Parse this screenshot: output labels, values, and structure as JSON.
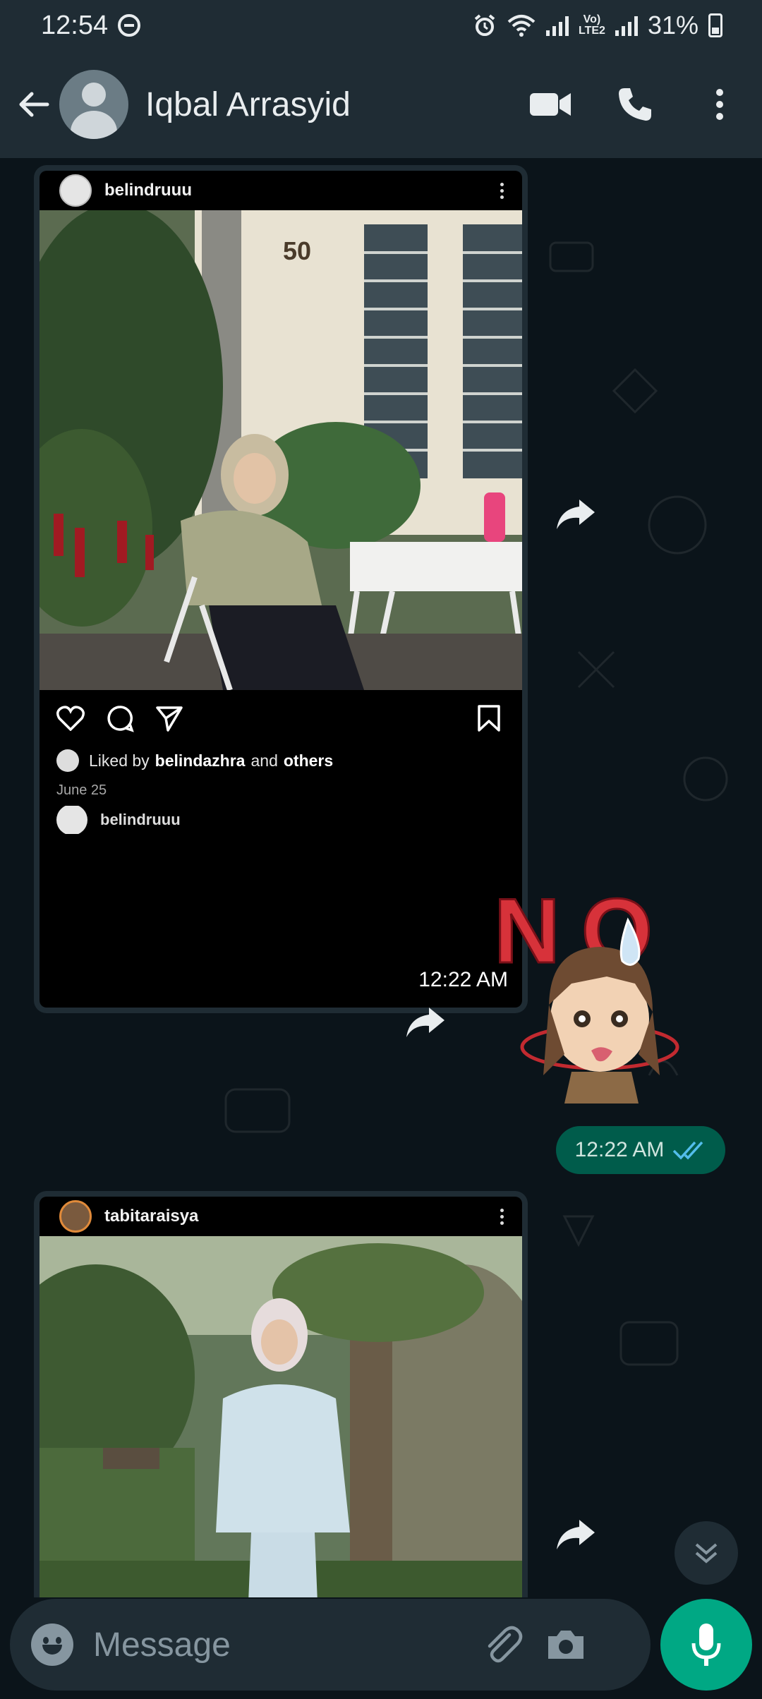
{
  "status_bar": {
    "time": "12:54",
    "battery": "31%",
    "network_label_top": "Vo)",
    "network_label_bottom": "LTE2",
    "icons": [
      "do-not-disturb-icon",
      "alarm-icon",
      "wifi-icon",
      "signal-icon",
      "volte-icon",
      "signal-icon",
      "battery-icon"
    ]
  },
  "header": {
    "contact_name": "Iqbal Arrasyid",
    "icons": [
      "back-arrow-icon",
      "avatar",
      "video-call-icon",
      "phone-icon",
      "more-vertical-icon"
    ]
  },
  "messages": [
    {
      "type": "instagram-share",
      "direction": "incoming",
      "ig_username": "belindruuu",
      "photo_text": "50",
      "liked_prefix": "Liked by",
      "liked_user": "belindazhra",
      "liked_and": "and",
      "liked_others": "others",
      "date": "June 25",
      "next_username": "belindruuu",
      "time": "12:22 AM"
    },
    {
      "type": "sticker",
      "direction": "outgoing",
      "sticker_text": "NO",
      "time": "12:22 AM",
      "status": "read"
    },
    {
      "type": "instagram-share",
      "direction": "incoming",
      "ig_username": "tabitaraisya"
    }
  ],
  "composer": {
    "placeholder": "Message",
    "icons": [
      "emoji-icon",
      "attach-icon",
      "camera-icon",
      "mic-icon"
    ]
  },
  "colors": {
    "header_bg": "#1f2c34",
    "chat_bg": "#0b141a",
    "incoming_bubble": "#1f2c34",
    "outgoing_bubble": "#005c4b",
    "accent": "#00a884",
    "read_tick": "#53bdeb"
  }
}
